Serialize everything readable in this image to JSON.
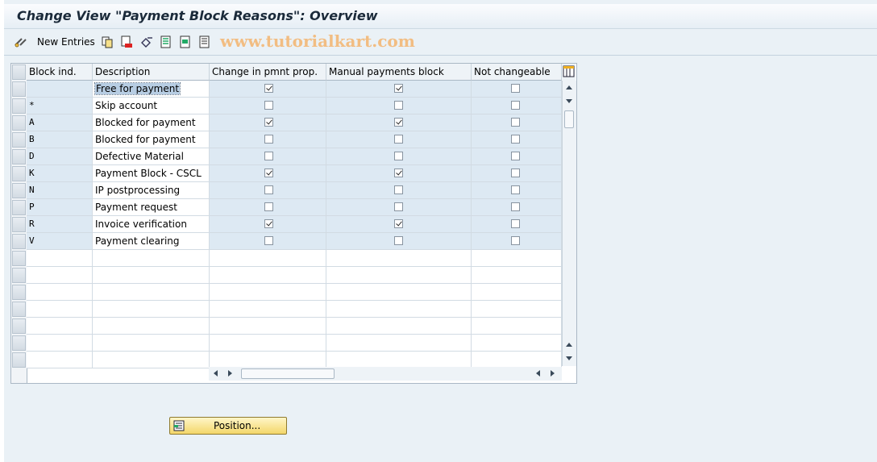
{
  "window": {
    "title": "Change View \"Payment Block Reasons\": Overview"
  },
  "toolbar": {
    "new_entries_label": "New Entries",
    "watermark": "www.tutorialkart.com",
    "icons": [
      "edit-glasses-icon",
      "copy-icon",
      "delete-icon",
      "undo-icon",
      "select-all-icon",
      "select-block-icon",
      "deselect-all-icon"
    ]
  },
  "table": {
    "columns": [
      "Block ind.",
      "Description",
      "Change in pmnt prop.",
      "Manual payments block",
      "Not changeable"
    ],
    "rows": [
      {
        "code": "",
        "description": "Free for payment",
        "change": true,
        "manual": true,
        "notchg": false
      },
      {
        "code": "*",
        "description": "Skip account",
        "change": false,
        "manual": false,
        "notchg": false
      },
      {
        "code": "A",
        "description": "Blocked for payment",
        "change": true,
        "manual": true,
        "notchg": false
      },
      {
        "code": "B",
        "description": "Blocked for payment",
        "change": false,
        "manual": false,
        "notchg": false
      },
      {
        "code": "D",
        "description": "Defective Material",
        "change": false,
        "manual": false,
        "notchg": false
      },
      {
        "code": "K",
        "description": "Payment Block - CSCL",
        "change": true,
        "manual": true,
        "notchg": false
      },
      {
        "code": "N",
        "description": "IP postprocessing",
        "change": false,
        "manual": false,
        "notchg": false
      },
      {
        "code": "P",
        "description": "Payment request",
        "change": false,
        "manual": false,
        "notchg": false
      },
      {
        "code": "R",
        "description": "Invoice verification",
        "change": true,
        "manual": true,
        "notchg": false
      },
      {
        "code": "V",
        "description": "Payment clearing",
        "change": false,
        "manual": false,
        "notchg": false
      }
    ]
  },
  "footer": {
    "position_button_label": "Position..."
  },
  "colors": {
    "accent_blue": "#dde9f3",
    "button_yellow": "#f3d66a",
    "watermark": "#f2bd82"
  }
}
